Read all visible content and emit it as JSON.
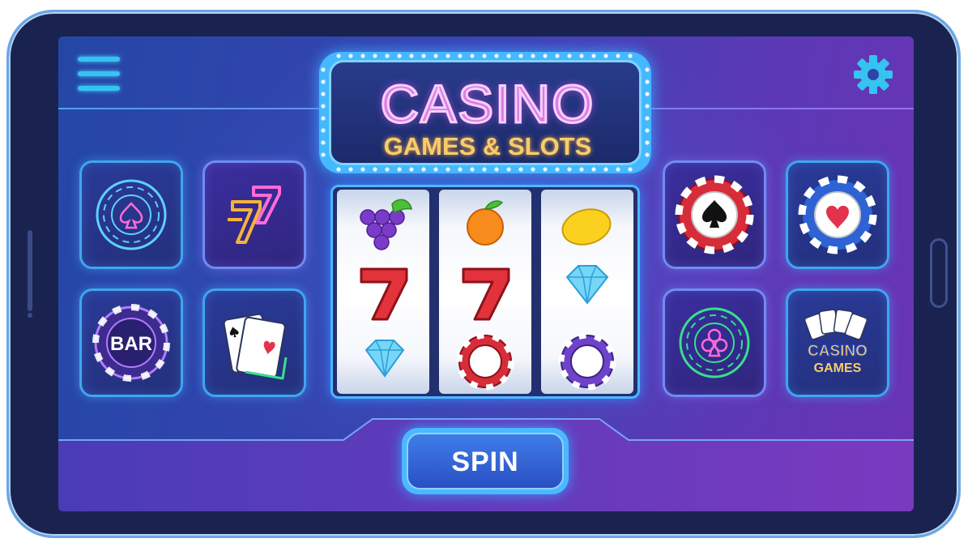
{
  "header": {
    "menu_icon": "hamburger-menu-icon",
    "settings_icon": "gear-icon"
  },
  "sign": {
    "title": "CASINO",
    "subtitle": "GAMES & SLOTS"
  },
  "left_tiles": [
    {
      "icon": "spade-chip-icon"
    },
    {
      "icon": "lucky-sevens-icon"
    },
    {
      "icon": "bar-chip-icon",
      "label": "BAR"
    },
    {
      "icon": "playing-cards-icon"
    }
  ],
  "right_tiles": [
    {
      "icon": "red-spade-chip-icon"
    },
    {
      "icon": "blue-heart-chip-icon"
    },
    {
      "icon": "club-chip-icon"
    },
    {
      "icon": "casino-games-icon",
      "label_top": "CASINO",
      "label_bottom": "GAMES"
    }
  ],
  "reels": [
    [
      "grapes-icon",
      "seven-icon",
      "diamond-icon"
    ],
    [
      "orange-icon",
      "seven-icon",
      "red-chip-icon"
    ],
    [
      "lemon-icon",
      "diamond-icon",
      "purple-chip-icon"
    ]
  ],
  "spin_button": {
    "label": "SPIN"
  },
  "colors": {
    "frame": "#1a2350",
    "screen_blue": "#2447a6",
    "screen_purple": "#6a34b4",
    "neon_blue": "#3fa6ee",
    "sign_pink": "#e07be0",
    "sign_gold": "#f7cd6b",
    "spin_button": "#2a4fc4"
  }
}
